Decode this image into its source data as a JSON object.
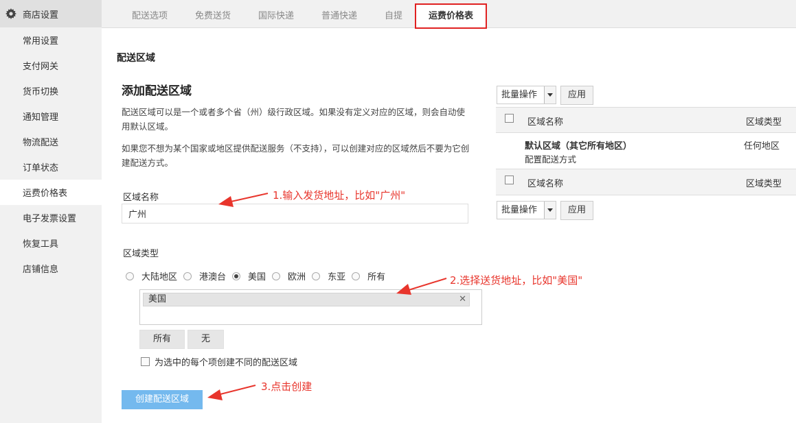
{
  "sidebar": {
    "header": "商店设置",
    "items": [
      {
        "label": "常用设置"
      },
      {
        "label": "支付网关"
      },
      {
        "label": "货币切换"
      },
      {
        "label": "通知管理"
      },
      {
        "label": "物流配送"
      },
      {
        "label": "订单状态"
      },
      {
        "label": "运费价格表",
        "active": true
      },
      {
        "label": "电子发票设置"
      },
      {
        "label": "恢复工具"
      },
      {
        "label": "店铺信息"
      }
    ]
  },
  "tabs": [
    {
      "label": "配送选项"
    },
    {
      "label": "免费送货"
    },
    {
      "label": "国际快递"
    },
    {
      "label": "普通快递"
    },
    {
      "label": "自提"
    },
    {
      "label": "运费价格表",
      "active": true
    }
  ],
  "main": {
    "section_title": "配送区域",
    "form_title": "添加配送区域",
    "desc1": "配送区域可以是一个或者多个省（州）级行政区域。如果没有定义对应的区域，则会自动使用默认区域。",
    "desc2": "如果您不想为某个国家或地区提供配送服务（不支持），可以创建对应的区域然后不要为它创建配送方式。",
    "zone_name_label": "区域名称",
    "zone_name_value": "广州",
    "zone_type_label": "区域类型",
    "zone_types": [
      {
        "label": "大陆地区",
        "checked": false
      },
      {
        "label": "港澳台",
        "checked": false
      },
      {
        "label": "美国",
        "checked": true
      },
      {
        "label": "欧洲",
        "checked": false
      },
      {
        "label": "东亚",
        "checked": false
      },
      {
        "label": "所有",
        "checked": false
      }
    ],
    "selected_tag": "美国",
    "tag_close": "✕",
    "all_button": "所有",
    "none_button": "无",
    "separate_zone_checkbox": "为选中的每个项创建不同的配送区域",
    "create_button": "创建配送区域"
  },
  "zone_table": {
    "bulk_action": "批量操作",
    "apply": "应用",
    "col_name": "区域名称",
    "col_type": "区域类型",
    "rows": [
      {
        "name": "默认区域（其它所有地区）",
        "sub": "配置配送方式",
        "type": "任何地区"
      }
    ]
  },
  "annotations": {
    "step1": "1.输入发货地址，比如\"广州\"",
    "step2": "2.选择送货地址，比如\"美国\"",
    "step3": "3.点击创建"
  },
  "colors": {
    "accent": "#74b9ee",
    "annotation": "#e8352c",
    "active_tab_border": "#e02020"
  }
}
